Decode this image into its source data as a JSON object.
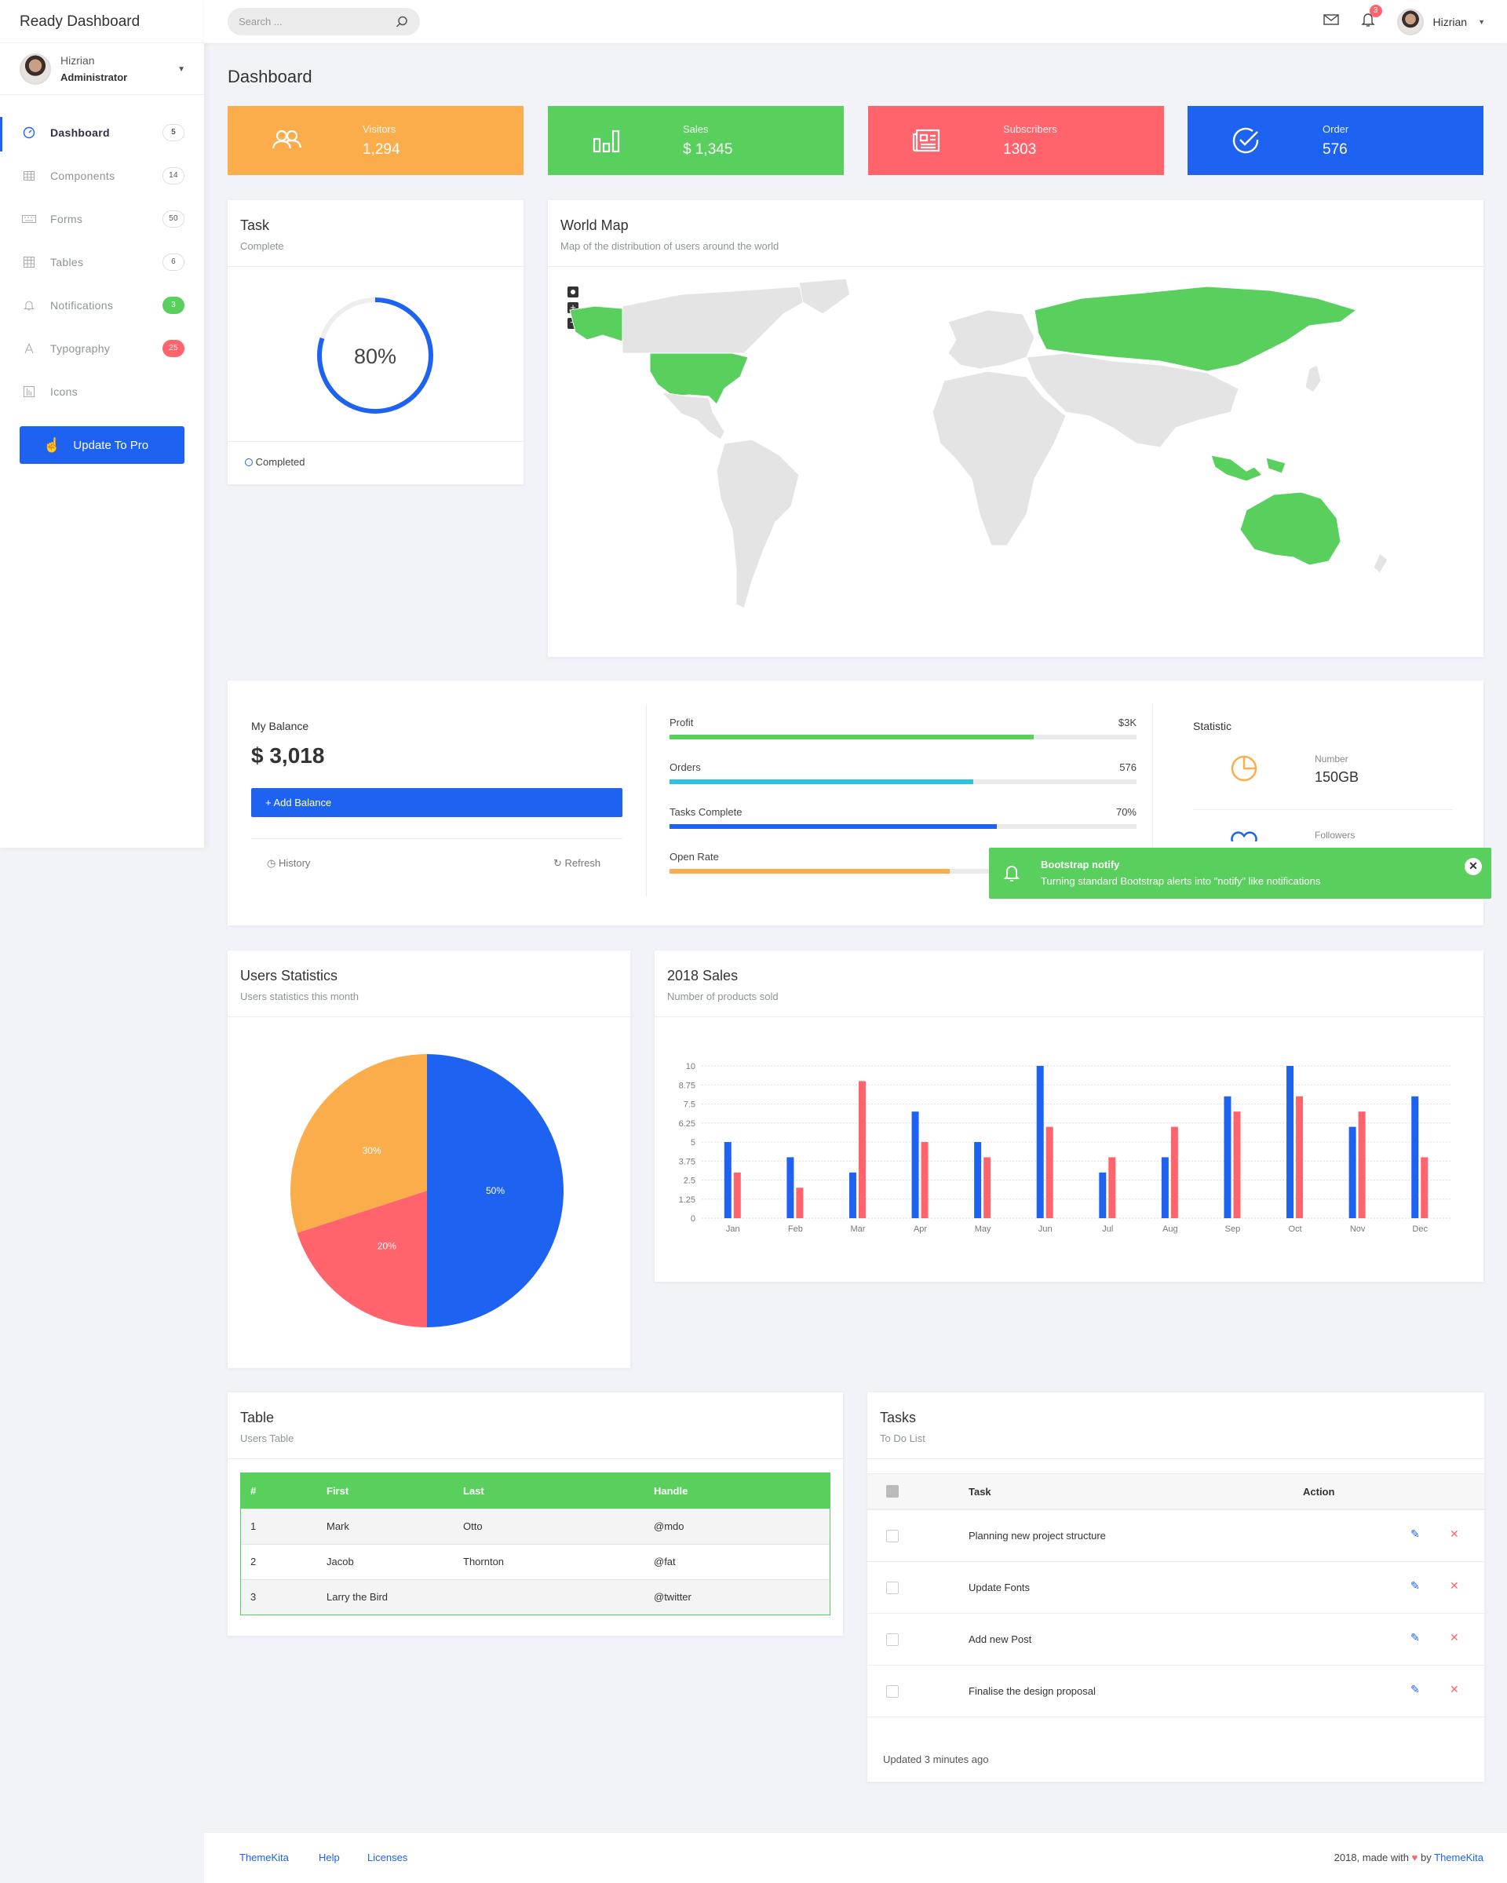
{
  "brand": "Ready Dashboard",
  "user": {
    "name": "Hizrian",
    "role": "Administrator"
  },
  "sidebar": {
    "items": [
      {
        "label": "Dashboard",
        "badge": "5",
        "icon": "dashboard-icon"
      },
      {
        "label": "Components",
        "badge": "14",
        "icon": "table-icon"
      },
      {
        "label": "Forms",
        "badge": "50",
        "icon": "keyboard-icon"
      },
      {
        "label": "Tables",
        "badge": "6",
        "icon": "grid-icon"
      },
      {
        "label": "Notifications",
        "badge": "3",
        "icon": "bell-icon"
      },
      {
        "label": "Typography",
        "badge": "25",
        "icon": "type-icon"
      },
      {
        "label": "Icons",
        "badge": "",
        "icon": "columns-icon"
      }
    ],
    "pro_button": "Update To Pro"
  },
  "topbar": {
    "search_placeholder": "Search ...",
    "notifications_count": "3",
    "user_name": "Hizrian"
  },
  "page_title": "Dashboard",
  "stats": [
    {
      "label": "Visitors",
      "value": "1,294",
      "color": "#fbad4c",
      "icon": "users-icon"
    },
    {
      "label": "Sales",
      "value": "$ 1,345",
      "color": "#59d05d",
      "icon": "bar-chart-icon"
    },
    {
      "label": "Subscribers",
      "value": "1303",
      "color": "#ff646d",
      "icon": "newspaper-icon"
    },
    {
      "label": "Order",
      "value": "576",
      "color": "#1d62f0",
      "icon": "check-circle-icon"
    }
  ],
  "task_card": {
    "title": "Task",
    "category": "Complete",
    "percent": 80,
    "percent_text": "80%",
    "legend": "Completed"
  },
  "world_map": {
    "title": "World Map",
    "category": "Map of the distribution of users around the world"
  },
  "balance": {
    "label": "My Balance",
    "amount": "$ 3,018",
    "add_button": "+ Add Balance",
    "history": "History",
    "refresh": "Refresh"
  },
  "progress": [
    {
      "label": "Profit",
      "value": "$3K",
      "fraction": 0.78,
      "color": "#59d05d"
    },
    {
      "label": "Orders",
      "value": "576",
      "fraction": 0.65,
      "color": "#2bc0e4"
    },
    {
      "label": "Tasks Complete",
      "value": "70%",
      "fraction": 0.7,
      "color": "#1d62f0"
    },
    {
      "label": "Open Rate",
      "value": "",
      "fraction": 0.6,
      "color": "#fbad4c"
    }
  ],
  "statistic": {
    "title": "Statistic",
    "number_label": "Number",
    "number_value": "150GB",
    "followers_label": "Followers"
  },
  "notify": {
    "title": "Bootstrap notify",
    "message": "Turning standard Bootstrap alerts into \"notify\" like notifications"
  },
  "users_stats": {
    "title": "Users Statistics",
    "category": "Users statistics this month"
  },
  "sales_card": {
    "title": "2018 Sales",
    "category": "Number of products sold"
  },
  "table_card": {
    "title": "Table",
    "category": "Users Table",
    "headers": [
      "#",
      "First",
      "Last",
      "Handle"
    ],
    "rows": [
      [
        "1",
        "Mark",
        "Otto",
        "@mdo"
      ],
      [
        "2",
        "Jacob",
        "Thornton",
        "@fat"
      ],
      [
        "3",
        "Larry the Bird",
        "",
        "@twitter"
      ]
    ]
  },
  "tasks_card": {
    "title": "Tasks",
    "category": "To Do List",
    "col_task": "Task",
    "col_action": "Action",
    "items": [
      "Planning new project structure",
      "Update Fonts",
      "Add new Post",
      "Finalise the design proposal"
    ],
    "updated": "Updated 3 minutes ago"
  },
  "footer": {
    "links": [
      "ThemeKita",
      "Help",
      "Licenses"
    ],
    "credit_prefix": "2018, made with",
    "credit_by": "by",
    "credit_link": "ThemeKita"
  },
  "chart_data": [
    {
      "type": "pie",
      "categories": [
        "",
        "",
        ""
      ],
      "values": [
        50,
        20,
        30
      ],
      "labels": [
        "50%",
        "20%",
        "30%"
      ],
      "colors": [
        "#1d62f0",
        "#ff646d",
        "#fbad4c"
      ]
    },
    {
      "type": "bar",
      "categories": [
        "Jan",
        "Feb",
        "Mar",
        "Apr",
        "May",
        "Jun",
        "Jul",
        "Aug",
        "Sep",
        "Oct",
        "Nov",
        "Dec"
      ],
      "series": [
        {
          "values": [
            5,
            4,
            3,
            7,
            5,
            10,
            3,
            4,
            8,
            10,
            6,
            8
          ],
          "color": "#1d62f0"
        },
        {
          "values": [
            3,
            2,
            9,
            5,
            4,
            6,
            4,
            6,
            7,
            8,
            7,
            4
          ],
          "color": "#ff646d"
        }
      ],
      "yticks": [
        "0",
        "1.25",
        "2.5",
        "3.75",
        "5",
        "6.25",
        "7.5",
        "8.75",
        "10"
      ],
      "ylim": [
        0,
        10
      ],
      "grid": true
    }
  ]
}
